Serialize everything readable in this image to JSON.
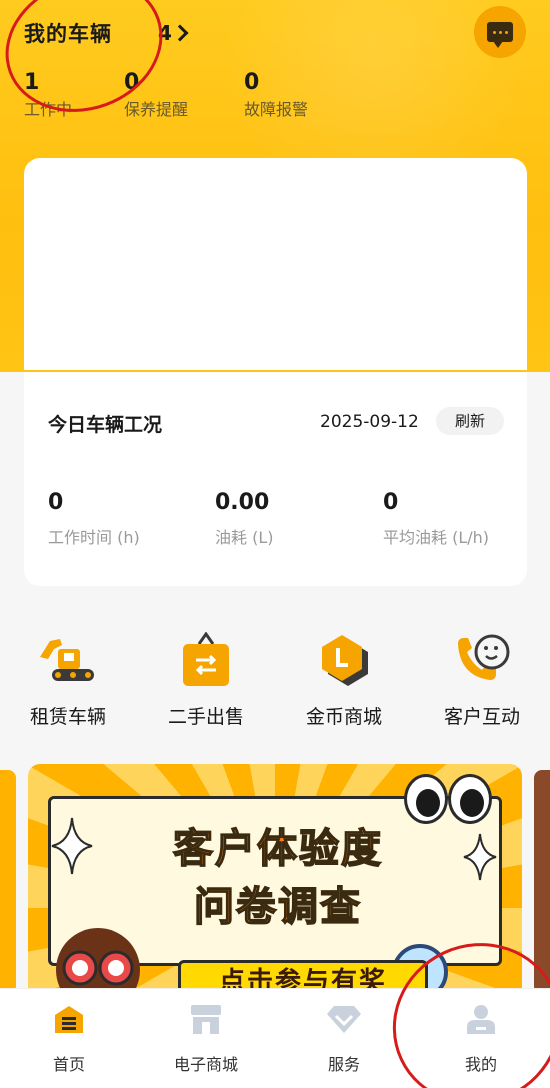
{
  "header": {
    "title": "我的车辆",
    "vehicle_count": "4",
    "stats": [
      {
        "value": "1",
        "label": "工作中"
      },
      {
        "value": "0",
        "label": "保养提醒"
      },
      {
        "value": "0",
        "label": "故障报警"
      }
    ]
  },
  "condition_card": {
    "title": "今日车辆工况",
    "date": "2025-09-12",
    "refresh_label": "刷新",
    "metrics": [
      {
        "value": "0",
        "label": "工作时间 (h)"
      },
      {
        "value": "0.00",
        "label": "油耗 (L)"
      },
      {
        "value": "0",
        "label": "平均油耗 (L/h)"
      }
    ]
  },
  "shortcuts": [
    {
      "label": "租赁车辆",
      "icon": "excavator-icon"
    },
    {
      "label": "二手出售",
      "icon": "exchange-bag-icon"
    },
    {
      "label": "金币商城",
      "icon": "gold-coin-icon"
    },
    {
      "label": "客户互动",
      "icon": "phone-smile-icon"
    }
  ],
  "banner": {
    "line1": "客户体验度",
    "line2": "问卷调查",
    "cta": "点击参与有奖"
  },
  "tabbar": [
    {
      "label": "首页",
      "icon": "home-icon",
      "active": true
    },
    {
      "label": "电子商城",
      "icon": "store-icon",
      "active": false
    },
    {
      "label": "服务",
      "icon": "diamond-icon",
      "active": false
    },
    {
      "label": "我的",
      "icon": "user-icon",
      "active": false
    }
  ],
  "colors": {
    "accent": "#ffc414",
    "active_tab": "#f5a400",
    "inactive_tab": "#c9d2dc"
  }
}
